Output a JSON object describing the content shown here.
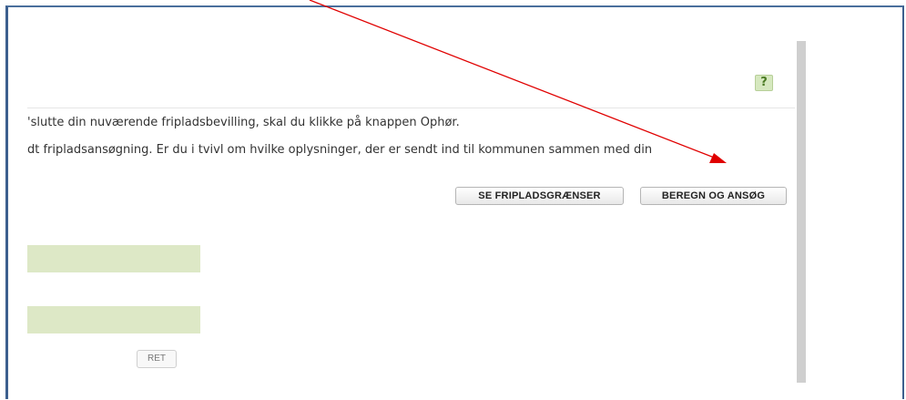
{
  "help": {
    "label": "?"
  },
  "text": {
    "line1": "'slutte din nuværende fripladsbevilling, skal du klikke på knappen Ophør.",
    "line2": "dt fripladsansøgning. Er du i tvivl om hvilke oplysninger, der er sendt ind til kommunen sammen med din"
  },
  "buttons": {
    "fripladsgraenser": "SE FRIPLADSGRÆNSER",
    "beregn": "BEREGN OG ANSØG",
    "ret": "RET"
  },
  "colors": {
    "frame": "#3c5f8e",
    "annotation_arrow": "#e00000",
    "field_fill": "#dde8c6"
  }
}
